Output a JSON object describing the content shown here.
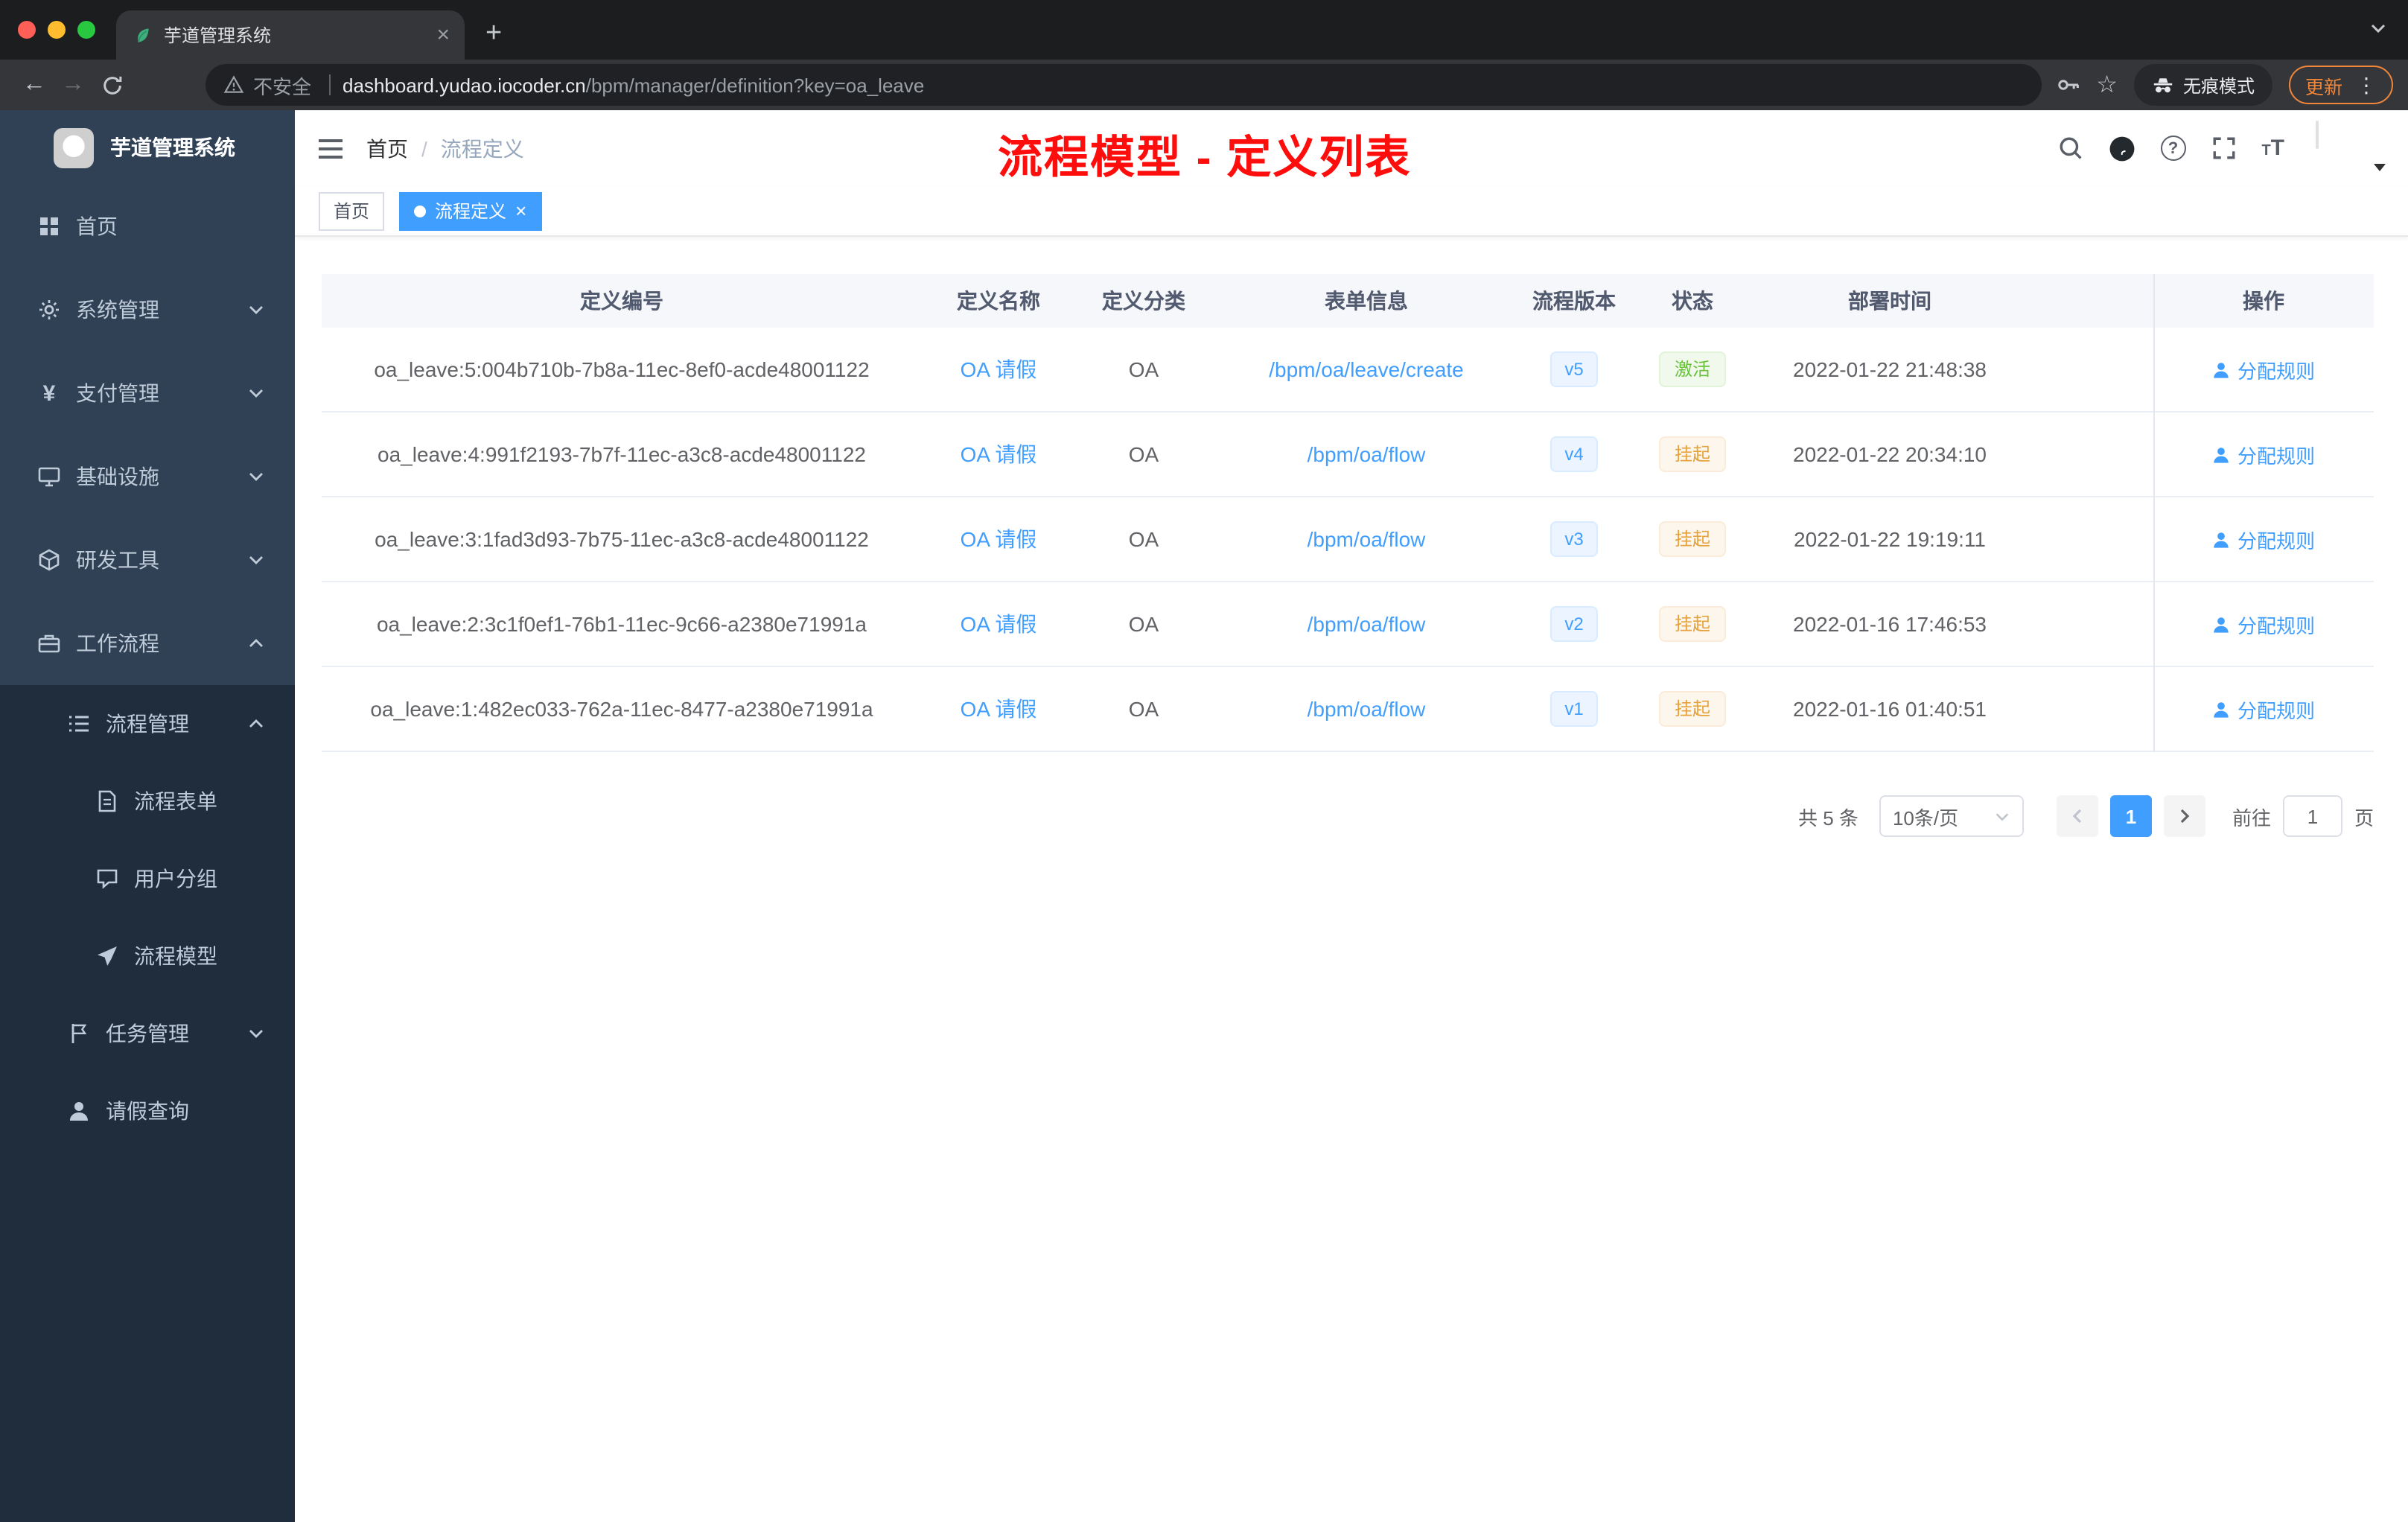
{
  "browser": {
    "tab_title": "芋道管理系统",
    "address": {
      "security_label": "不安全",
      "domain": "dashboard.yudao.iocoder.cn",
      "path": "/bpm/manager/definition?key=oa_leave"
    },
    "incognito_label": "无痕模式",
    "update_label": "更新"
  },
  "glyphs": {
    "close": "×",
    "new_tab": "+",
    "back": "←",
    "forward": "→",
    "star": "☆",
    "more": "⋮",
    "yen": "¥",
    "question": "?",
    "font_small": "T",
    "font_big": "T",
    "slash": "/"
  },
  "sidebar": {
    "title": "芋道管理系统",
    "items": [
      {
        "label": "首页"
      },
      {
        "label": "系统管理"
      },
      {
        "label": "支付管理"
      },
      {
        "label": "基础设施"
      },
      {
        "label": "研发工具"
      },
      {
        "label": "工作流程"
      },
      {
        "label": "流程管理"
      },
      {
        "label": "流程表单"
      },
      {
        "label": "用户分组"
      },
      {
        "label": "流程模型"
      },
      {
        "label": "任务管理"
      },
      {
        "label": "请假查询"
      }
    ]
  },
  "header": {
    "breadcrumb_home": "首页",
    "breadcrumb_current": "流程定义",
    "annotation": "流程模型 - 定义列表",
    "annotation_color": "#fe0d0d"
  },
  "tags": {
    "home": "首页",
    "active": "流程定义"
  },
  "table": {
    "columns": [
      "定义编号",
      "定义名称",
      "定义分类",
      "表单信息",
      "流程版本",
      "状态",
      "部署时间",
      "操作"
    ],
    "action_label": "分配规则",
    "rows": [
      {
        "id": "oa_leave:5:004b710b-7b8a-11ec-8ef0-acde48001122",
        "name": "OA 请假",
        "category": "OA",
        "form": "/bpm/oa/leave/create",
        "version": "v5",
        "status": "激活",
        "time": "2022-01-22 21:48:38"
      },
      {
        "id": "oa_leave:4:991f2193-7b7f-11ec-a3c8-acde48001122",
        "name": "OA 请假",
        "category": "OA",
        "form": "/bpm/oa/flow",
        "version": "v4",
        "status": "挂起",
        "time": "2022-01-22 20:34:10"
      },
      {
        "id": "oa_leave:3:1fad3d93-7b75-11ec-a3c8-acde48001122",
        "name": "OA 请假",
        "category": "OA",
        "form": "/bpm/oa/flow",
        "version": "v3",
        "status": "挂起",
        "time": "2022-01-22 19:19:11"
      },
      {
        "id": "oa_leave:2:3c1f0ef1-76b1-11ec-9c66-a2380e71991a",
        "name": "OA 请假",
        "category": "OA",
        "form": "/bpm/oa/flow",
        "version": "v2",
        "status": "挂起",
        "time": "2022-01-16 17:46:53"
      },
      {
        "id": "oa_leave:1:482ec033-762a-11ec-8477-a2380e71991a",
        "name": "OA 请假",
        "category": "OA",
        "form": "/bpm/oa/flow",
        "version": "v1",
        "status": "挂起",
        "time": "2022-01-16 01:40:51"
      }
    ]
  },
  "pagination": {
    "total": "共 5 条",
    "page_size": "10条/页",
    "current_page": "1",
    "goto_label": "前往",
    "goto_value": "1",
    "page_unit": "页"
  },
  "colors": {
    "accent": "#409eff",
    "success": "#67c23a",
    "warning": "#e6a23c",
    "sidebar_bg": "#304156",
    "submenu_bg": "#1f2d3d"
  }
}
